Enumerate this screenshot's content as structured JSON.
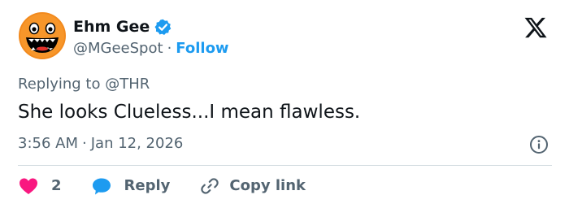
{
  "author": {
    "display_name": "Ehm Gee",
    "handle": "@MGeeSpot",
    "separator": "·",
    "follow_label": "Follow",
    "verified": true,
    "avatar_icon": "orange-smiley-face-icon"
  },
  "brand": {
    "logo_icon": "x-logo-icon"
  },
  "reply_context": {
    "prefix": "Replying to",
    "mention": "@THR"
  },
  "tweet": {
    "text": "She looks Clueless...I mean flawless.",
    "time": "3:56 AM",
    "separator": "·",
    "date": "Jan 12, 2026"
  },
  "actions": {
    "like_count": "2",
    "reply_label": "Reply",
    "copy_link_label": "Copy link"
  },
  "colors": {
    "accent": "#1d9bf0",
    "secondary_text": "#536471",
    "primary_text": "#0f1419",
    "heart": "#f91880",
    "avatar_orange": "#f28a1e"
  }
}
